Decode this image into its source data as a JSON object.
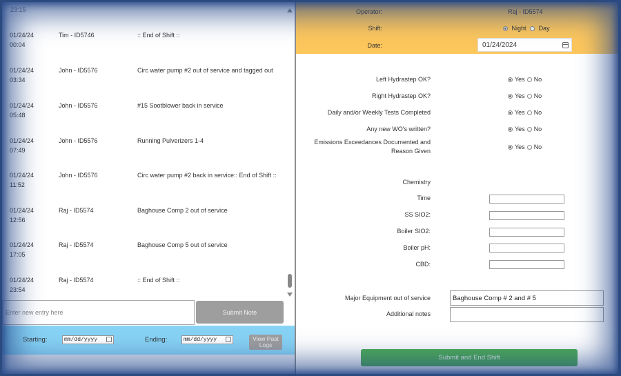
{
  "log": {
    "top_partial_time": "23:15",
    "entries": [
      {
        "date": "01/24/24",
        "time": "00:04",
        "operator": "Tim - ID5746",
        "note": ":: End of Shift ::"
      },
      {
        "date": "01/24/24",
        "time": "03:34",
        "operator": "John - ID5576",
        "note": "Circ water pump #2 out of service and tagged out"
      },
      {
        "date": "01/24/24",
        "time": "05:48",
        "operator": "John - ID5576",
        "note": "#15 Sootblower back in service"
      },
      {
        "date": "01/24/24",
        "time": "07:49",
        "operator": "John - ID5576",
        "note": "Running Pulverizers 1-4"
      },
      {
        "date": "01/24/24",
        "time": "11:52",
        "operator": "John - ID5576",
        "note": "Circ water pump #2 back in service:: End of Shift ::"
      },
      {
        "date": "01/24/24",
        "time": "12:56",
        "operator": "Raj - ID5574",
        "note": "Baghouse Comp 2 out of service"
      },
      {
        "date": "01/24/24",
        "time": "17:05",
        "operator": "Raj - ID5574",
        "note": "Baghouse Comp 5 out of service"
      },
      {
        "date": "01/24/24",
        "time": "23:54",
        "operator": "Raj - ID5574",
        "note": ":: End of Shift ::"
      }
    ],
    "new_entry_placeholder": "Enter new entry here",
    "new_entry_value": "",
    "submit_note_label": "Submit Note"
  },
  "filter": {
    "starting_label": "Starting:",
    "ending_label": "Ending:",
    "date_placeholder": "mm/dd/yyyy",
    "view_past_logs_label": "View Past Logs"
  },
  "header": {
    "operator_label": "Operator:",
    "operator_value": "Raj - ID5574",
    "shift_label": "Shift:",
    "shift_options": [
      "Night",
      "Day"
    ],
    "shift_selected": "Night",
    "date_label": "Date:",
    "date_value": "01/24/2024"
  },
  "checklist": [
    {
      "question": "Left Hydrastep OK?",
      "answer": "Yes"
    },
    {
      "question": "Right Hydrastep OK?",
      "answer": "Yes"
    },
    {
      "question": "Daily and/or Weekly Tests Completed",
      "answer": "Yes"
    },
    {
      "question": "Any new WO's written?",
      "answer": "Yes"
    },
    {
      "question": "Emissions Exceedances Documented and Reason Given",
      "answer": "Yes"
    }
  ],
  "yes_label": "Yes",
  "no_label": "No",
  "chemistry": {
    "heading": "Chemistry",
    "fields": [
      {
        "label": "Time",
        "value": ""
      },
      {
        "label": "SS SIO2:",
        "value": ""
      },
      {
        "label": "Boiler SIO2:",
        "value": ""
      },
      {
        "label": "Boiler pH:",
        "value": ""
      },
      {
        "label": "CBD:",
        "value": ""
      }
    ]
  },
  "equipment": {
    "major_label": "Major Equipment out of service",
    "major_value": "Baghouse Comp # 2 and # 5",
    "notes_label": "Additional notes",
    "notes_value": ""
  },
  "submit_end_label": "Submit and End Shift"
}
